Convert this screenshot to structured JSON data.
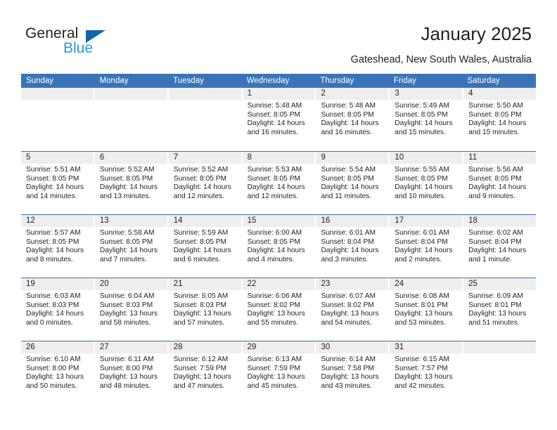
{
  "logo": {
    "name_top": "General",
    "name_bottom": "Blue",
    "triangle_color": "#1464aa",
    "blue_color": "#2e93de"
  },
  "header": {
    "title": "January 2025",
    "location": "Gateshead, New South Wales, Australia"
  },
  "theme": {
    "header_blue": "#3a74b8",
    "day_band_gray": "#eeeeee",
    "text_color": "#231f20"
  },
  "weekdays": [
    "Sunday",
    "Monday",
    "Tuesday",
    "Wednesday",
    "Thursday",
    "Friday",
    "Saturday"
  ],
  "labels": {
    "sunrise": "Sunrise:",
    "sunset": "Sunset:",
    "daylight": "Daylight:"
  },
  "weeks": [
    [
      {
        "day": "",
        "empty": true
      },
      {
        "day": "",
        "empty": true
      },
      {
        "day": "",
        "empty": true
      },
      {
        "day": "1",
        "sunrise": "Sunrise: 5:48 AM",
        "sunset": "Sunset: 8:05 PM",
        "daylight": "Daylight: 14 hours and 16 minutes."
      },
      {
        "day": "2",
        "sunrise": "Sunrise: 5:48 AM",
        "sunset": "Sunset: 8:05 PM",
        "daylight": "Daylight: 14 hours and 16 minutes."
      },
      {
        "day": "3",
        "sunrise": "Sunrise: 5:49 AM",
        "sunset": "Sunset: 8:05 PM",
        "daylight": "Daylight: 14 hours and 15 minutes."
      },
      {
        "day": "4",
        "sunrise": "Sunrise: 5:50 AM",
        "sunset": "Sunset: 8:05 PM",
        "daylight": "Daylight: 14 hours and 15 minutes."
      }
    ],
    [
      {
        "day": "5",
        "sunrise": "Sunrise: 5:51 AM",
        "sunset": "Sunset: 8:05 PM",
        "daylight": "Daylight: 14 hours and 14 minutes."
      },
      {
        "day": "6",
        "sunrise": "Sunrise: 5:52 AM",
        "sunset": "Sunset: 8:05 PM",
        "daylight": "Daylight: 14 hours and 13 minutes."
      },
      {
        "day": "7",
        "sunrise": "Sunrise: 5:52 AM",
        "sunset": "Sunset: 8:05 PM",
        "daylight": "Daylight: 14 hours and 12 minutes."
      },
      {
        "day": "8",
        "sunrise": "Sunrise: 5:53 AM",
        "sunset": "Sunset: 8:05 PM",
        "daylight": "Daylight: 14 hours and 12 minutes."
      },
      {
        "day": "9",
        "sunrise": "Sunrise: 5:54 AM",
        "sunset": "Sunset: 8:05 PM",
        "daylight": "Daylight: 14 hours and 11 minutes."
      },
      {
        "day": "10",
        "sunrise": "Sunrise: 5:55 AM",
        "sunset": "Sunset: 8:05 PM",
        "daylight": "Daylight: 14 hours and 10 minutes."
      },
      {
        "day": "11",
        "sunrise": "Sunrise: 5:56 AM",
        "sunset": "Sunset: 8:05 PM",
        "daylight": "Daylight: 14 hours and 9 minutes."
      }
    ],
    [
      {
        "day": "12",
        "sunrise": "Sunrise: 5:57 AM",
        "sunset": "Sunset: 8:05 PM",
        "daylight": "Daylight: 14 hours and 8 minutes."
      },
      {
        "day": "13",
        "sunrise": "Sunrise: 5:58 AM",
        "sunset": "Sunset: 8:05 PM",
        "daylight": "Daylight: 14 hours and 7 minutes."
      },
      {
        "day": "14",
        "sunrise": "Sunrise: 5:59 AM",
        "sunset": "Sunset: 8:05 PM",
        "daylight": "Daylight: 14 hours and 6 minutes."
      },
      {
        "day": "15",
        "sunrise": "Sunrise: 6:00 AM",
        "sunset": "Sunset: 8:05 PM",
        "daylight": "Daylight: 14 hours and 4 minutes."
      },
      {
        "day": "16",
        "sunrise": "Sunrise: 6:01 AM",
        "sunset": "Sunset: 8:04 PM",
        "daylight": "Daylight: 14 hours and 3 minutes."
      },
      {
        "day": "17",
        "sunrise": "Sunrise: 6:01 AM",
        "sunset": "Sunset: 8:04 PM",
        "daylight": "Daylight: 14 hours and 2 minutes."
      },
      {
        "day": "18",
        "sunrise": "Sunrise: 6:02 AM",
        "sunset": "Sunset: 8:04 PM",
        "daylight": "Daylight: 14 hours and 1 minute."
      }
    ],
    [
      {
        "day": "19",
        "sunrise": "Sunrise: 6:03 AM",
        "sunset": "Sunset: 8:03 PM",
        "daylight": "Daylight: 14 hours and 0 minutes."
      },
      {
        "day": "20",
        "sunrise": "Sunrise: 6:04 AM",
        "sunset": "Sunset: 8:03 PM",
        "daylight": "Daylight: 13 hours and 58 minutes."
      },
      {
        "day": "21",
        "sunrise": "Sunrise: 6:05 AM",
        "sunset": "Sunset: 8:03 PM",
        "daylight": "Daylight: 13 hours and 57 minutes."
      },
      {
        "day": "22",
        "sunrise": "Sunrise: 6:06 AM",
        "sunset": "Sunset: 8:02 PM",
        "daylight": "Daylight: 13 hours and 55 minutes."
      },
      {
        "day": "23",
        "sunrise": "Sunrise: 6:07 AM",
        "sunset": "Sunset: 8:02 PM",
        "daylight": "Daylight: 13 hours and 54 minutes."
      },
      {
        "day": "24",
        "sunrise": "Sunrise: 6:08 AM",
        "sunset": "Sunset: 8:01 PM",
        "daylight": "Daylight: 13 hours and 53 minutes."
      },
      {
        "day": "25",
        "sunrise": "Sunrise: 6:09 AM",
        "sunset": "Sunset: 8:01 PM",
        "daylight": "Daylight: 13 hours and 51 minutes."
      }
    ],
    [
      {
        "day": "26",
        "sunrise": "Sunrise: 6:10 AM",
        "sunset": "Sunset: 8:00 PM",
        "daylight": "Daylight: 13 hours and 50 minutes."
      },
      {
        "day": "27",
        "sunrise": "Sunrise: 6:11 AM",
        "sunset": "Sunset: 8:00 PM",
        "daylight": "Daylight: 13 hours and 48 minutes."
      },
      {
        "day": "28",
        "sunrise": "Sunrise: 6:12 AM",
        "sunset": "Sunset: 7:59 PM",
        "daylight": "Daylight: 13 hours and 47 minutes."
      },
      {
        "day": "29",
        "sunrise": "Sunrise: 6:13 AM",
        "sunset": "Sunset: 7:59 PM",
        "daylight": "Daylight: 13 hours and 45 minutes."
      },
      {
        "day": "30",
        "sunrise": "Sunrise: 6:14 AM",
        "sunset": "Sunset: 7:58 PM",
        "daylight": "Daylight: 13 hours and 43 minutes."
      },
      {
        "day": "31",
        "sunrise": "Sunrise: 6:15 AM",
        "sunset": "Sunset: 7:57 PM",
        "daylight": "Daylight: 13 hours and 42 minutes."
      },
      {
        "day": "",
        "empty": true
      }
    ]
  ]
}
